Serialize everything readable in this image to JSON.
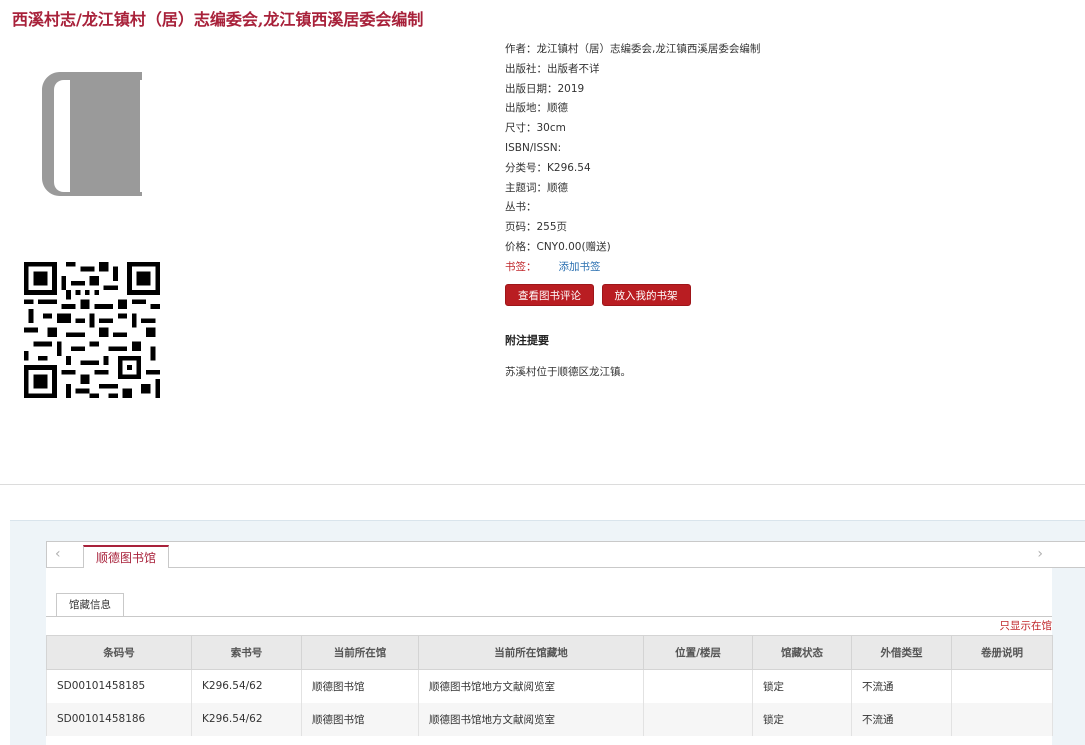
{
  "title": "西溪村志/龙江镇村（居）志编委会,龙江镇西溪居委会编制",
  "details": [
    {
      "label": "作者：",
      "value": "龙江镇村（居）志编委会,龙江镇西溪居委会编制"
    },
    {
      "label": "出版社：",
      "value": "出版者不详"
    },
    {
      "label": "出版日期：",
      "value": "2019"
    },
    {
      "label": "出版地：",
      "value": "顺德"
    },
    {
      "label": "尺寸：",
      "value": "30cm"
    },
    {
      "label": "ISBN/ISSN:",
      "value": ""
    },
    {
      "label": "分类号：",
      "value": "K296.54"
    },
    {
      "label": "主题词：",
      "value": "顺德"
    },
    {
      "label": "丛书：",
      "value": ""
    },
    {
      "label": "页码：",
      "value": "255页"
    },
    {
      "label": "价格：",
      "value": "CNY0.00(赠送)"
    }
  ],
  "bookmark": {
    "label": "书签：",
    "link": "添加书签"
  },
  "buttons": {
    "review": "查看图书评论",
    "shelf": "放入我的书架"
  },
  "note": {
    "heading": "附注提要",
    "text": "苏溪村位于顺德区龙江镇。"
  },
  "library_tab": "顺德图书馆",
  "subtab": "馆藏信息",
  "only_available": "只显示在馆",
  "table": {
    "columns": [
      "条码号",
      "索书号",
      "当前所在馆",
      "当前所在馆藏地",
      "位置/楼层",
      "馆藏状态",
      "外借类型",
      "卷册说明"
    ],
    "rows": [
      [
        "SD00101458185",
        "K296.54/62",
        "顺德图书馆",
        "顺德图书馆地方文献阅览室",
        "",
        "锁定",
        "不流通",
        ""
      ],
      [
        "SD00101458186",
        "K296.54/62",
        "顺德图书馆",
        "顺德图书馆地方文献阅览室",
        "",
        "锁定",
        "不流通",
        ""
      ]
    ]
  },
  "icons": {
    "cover": "book-cover-icon",
    "qr": "qr-code-icon",
    "prev": "chevron-left-icon",
    "next": "chevron-right-icon"
  },
  "colors": {
    "accent": "#a8213a",
    "button": "#b91d22",
    "link": "#2a6fb0"
  }
}
